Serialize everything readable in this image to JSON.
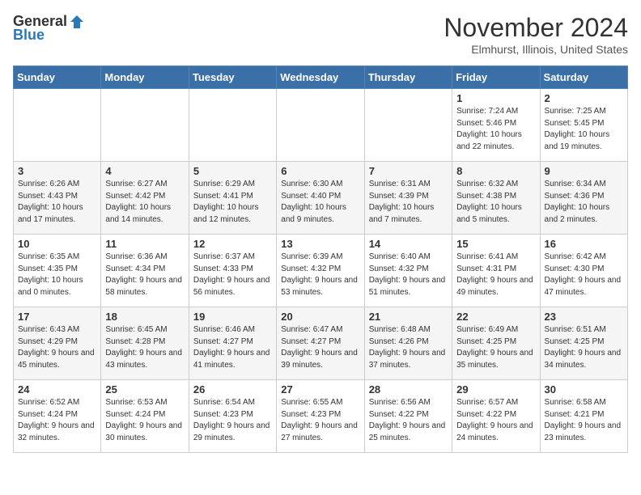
{
  "header": {
    "logo_general": "General",
    "logo_blue": "Blue",
    "month_title": "November 2024",
    "location": "Elmhurst, Illinois, United States"
  },
  "days_of_week": [
    "Sunday",
    "Monday",
    "Tuesday",
    "Wednesday",
    "Thursday",
    "Friday",
    "Saturday"
  ],
  "weeks": [
    [
      {
        "day": "",
        "info": ""
      },
      {
        "day": "",
        "info": ""
      },
      {
        "day": "",
        "info": ""
      },
      {
        "day": "",
        "info": ""
      },
      {
        "day": "",
        "info": ""
      },
      {
        "day": "1",
        "info": "Sunrise: 7:24 AM\nSunset: 5:46 PM\nDaylight: 10 hours and 22 minutes."
      },
      {
        "day": "2",
        "info": "Sunrise: 7:25 AM\nSunset: 5:45 PM\nDaylight: 10 hours and 19 minutes."
      }
    ],
    [
      {
        "day": "3",
        "info": "Sunrise: 6:26 AM\nSunset: 4:43 PM\nDaylight: 10 hours and 17 minutes."
      },
      {
        "day": "4",
        "info": "Sunrise: 6:27 AM\nSunset: 4:42 PM\nDaylight: 10 hours and 14 minutes."
      },
      {
        "day": "5",
        "info": "Sunrise: 6:29 AM\nSunset: 4:41 PM\nDaylight: 10 hours and 12 minutes."
      },
      {
        "day": "6",
        "info": "Sunrise: 6:30 AM\nSunset: 4:40 PM\nDaylight: 10 hours and 9 minutes."
      },
      {
        "day": "7",
        "info": "Sunrise: 6:31 AM\nSunset: 4:39 PM\nDaylight: 10 hours and 7 minutes."
      },
      {
        "day": "8",
        "info": "Sunrise: 6:32 AM\nSunset: 4:38 PM\nDaylight: 10 hours and 5 minutes."
      },
      {
        "day": "9",
        "info": "Sunrise: 6:34 AM\nSunset: 4:36 PM\nDaylight: 10 hours and 2 minutes."
      }
    ],
    [
      {
        "day": "10",
        "info": "Sunrise: 6:35 AM\nSunset: 4:35 PM\nDaylight: 10 hours and 0 minutes."
      },
      {
        "day": "11",
        "info": "Sunrise: 6:36 AM\nSunset: 4:34 PM\nDaylight: 9 hours and 58 minutes."
      },
      {
        "day": "12",
        "info": "Sunrise: 6:37 AM\nSunset: 4:33 PM\nDaylight: 9 hours and 56 minutes."
      },
      {
        "day": "13",
        "info": "Sunrise: 6:39 AM\nSunset: 4:32 PM\nDaylight: 9 hours and 53 minutes."
      },
      {
        "day": "14",
        "info": "Sunrise: 6:40 AM\nSunset: 4:32 PM\nDaylight: 9 hours and 51 minutes."
      },
      {
        "day": "15",
        "info": "Sunrise: 6:41 AM\nSunset: 4:31 PM\nDaylight: 9 hours and 49 minutes."
      },
      {
        "day": "16",
        "info": "Sunrise: 6:42 AM\nSunset: 4:30 PM\nDaylight: 9 hours and 47 minutes."
      }
    ],
    [
      {
        "day": "17",
        "info": "Sunrise: 6:43 AM\nSunset: 4:29 PM\nDaylight: 9 hours and 45 minutes."
      },
      {
        "day": "18",
        "info": "Sunrise: 6:45 AM\nSunset: 4:28 PM\nDaylight: 9 hours and 43 minutes."
      },
      {
        "day": "19",
        "info": "Sunrise: 6:46 AM\nSunset: 4:27 PM\nDaylight: 9 hours and 41 minutes."
      },
      {
        "day": "20",
        "info": "Sunrise: 6:47 AM\nSunset: 4:27 PM\nDaylight: 9 hours and 39 minutes."
      },
      {
        "day": "21",
        "info": "Sunrise: 6:48 AM\nSunset: 4:26 PM\nDaylight: 9 hours and 37 minutes."
      },
      {
        "day": "22",
        "info": "Sunrise: 6:49 AM\nSunset: 4:25 PM\nDaylight: 9 hours and 35 minutes."
      },
      {
        "day": "23",
        "info": "Sunrise: 6:51 AM\nSunset: 4:25 PM\nDaylight: 9 hours and 34 minutes."
      }
    ],
    [
      {
        "day": "24",
        "info": "Sunrise: 6:52 AM\nSunset: 4:24 PM\nDaylight: 9 hours and 32 minutes."
      },
      {
        "day": "25",
        "info": "Sunrise: 6:53 AM\nSunset: 4:24 PM\nDaylight: 9 hours and 30 minutes."
      },
      {
        "day": "26",
        "info": "Sunrise: 6:54 AM\nSunset: 4:23 PM\nDaylight: 9 hours and 29 minutes."
      },
      {
        "day": "27",
        "info": "Sunrise: 6:55 AM\nSunset: 4:23 PM\nDaylight: 9 hours and 27 minutes."
      },
      {
        "day": "28",
        "info": "Sunrise: 6:56 AM\nSunset: 4:22 PM\nDaylight: 9 hours and 25 minutes."
      },
      {
        "day": "29",
        "info": "Sunrise: 6:57 AM\nSunset: 4:22 PM\nDaylight: 9 hours and 24 minutes."
      },
      {
        "day": "30",
        "info": "Sunrise: 6:58 AM\nSunset: 4:21 PM\nDaylight: 9 hours and 23 minutes."
      }
    ]
  ]
}
